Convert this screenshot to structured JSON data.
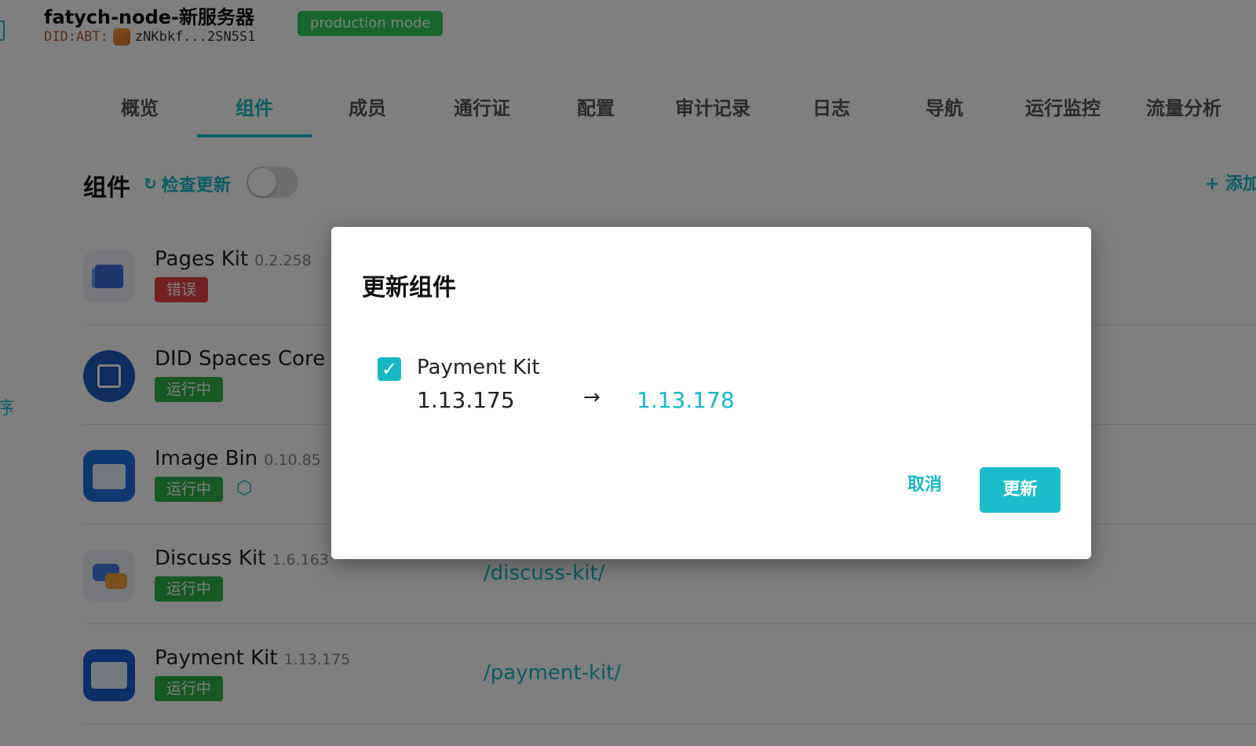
{
  "header": {
    "server_name": "fatych-node-新服务器",
    "did_prefix": "DID:ABT:",
    "did_value": "zNKbkf...2SN5S1",
    "mode_badge": "production mode"
  },
  "tabs": [
    {
      "label": "概览"
    },
    {
      "label": "组件",
      "active": true
    },
    {
      "label": "成员"
    },
    {
      "label": "通行证"
    },
    {
      "label": "配置"
    },
    {
      "label": "审计记录"
    },
    {
      "label": "日志"
    },
    {
      "label": "导航"
    },
    {
      "label": "运行监控"
    },
    {
      "label": "流量分析"
    }
  ],
  "section": {
    "title": "组件",
    "check_update": "检查更新",
    "add_label": "+ 添加"
  },
  "components": [
    {
      "name": "Pages Kit",
      "version": "0.2.258",
      "status": "错误",
      "path": ""
    },
    {
      "name": "DID Spaces Core",
      "version": "",
      "status": "运行中",
      "path": ""
    },
    {
      "name": "Image Bin",
      "version": "0.10.85",
      "status": "运行中",
      "path": ""
    },
    {
      "name": "Discuss Kit",
      "version": "1.6.163",
      "status": "运行中",
      "path": "/discuss-kit/"
    },
    {
      "name": "Payment Kit",
      "version": "1.13.175",
      "status": "运行中",
      "path": "/payment-kit/"
    }
  ],
  "left_side_char": "序",
  "dialog": {
    "title": "更新组件",
    "item": {
      "name": "Payment Kit",
      "checked": true,
      "from_version": "1.13.175",
      "to_version": "1.13.178"
    },
    "cancel_label": "取消",
    "update_label": "更新"
  },
  "colors": {
    "accent": "#17b8c5",
    "running": "#2fb04a",
    "error": "#e8424a",
    "production": "#2fcd5a"
  }
}
